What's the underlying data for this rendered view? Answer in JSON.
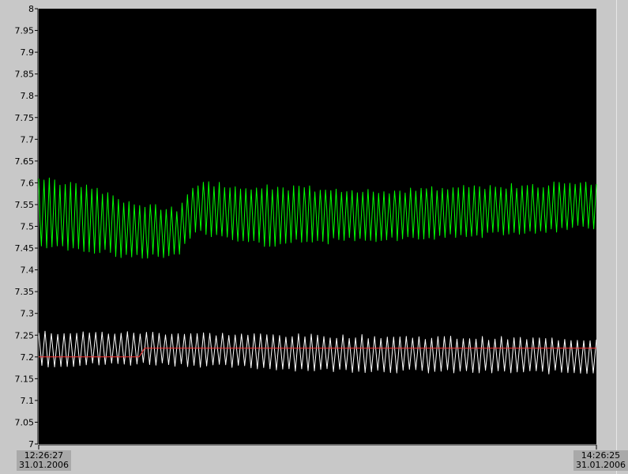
{
  "chart_data": {
    "type": "line",
    "title": "",
    "xlabel": "",
    "ylabel": "",
    "ylim": [
      7.0,
      8.0
    ],
    "y_ticks": [
      "8",
      "7.95",
      "7.9",
      "7.85",
      "7.8",
      "7.75",
      "7.7",
      "7.65",
      "7.6",
      "7.55",
      "7.5",
      "7.45",
      "7.4",
      "7.35",
      "7.3",
      "7.25",
      "7.2",
      "7.15",
      "7.1",
      "7.05",
      "7"
    ],
    "x_range": {
      "start_time": "12:26:27",
      "start_date": "31.01.2006",
      "end_time": "14:26:25",
      "end_date": "31.01.2006"
    },
    "grid": false,
    "background": "#000000",
    "series": [
      {
        "color": "#00ff00",
        "kind": "oscillating",
        "cycles": 105,
        "upper_envelope": [
          [
            0,
            7.61
          ],
          [
            0.07,
            7.59
          ],
          [
            0.12,
            7.58
          ],
          [
            0.17,
            7.55
          ],
          [
            0.25,
            7.54
          ],
          [
            0.28,
            7.6
          ],
          [
            0.4,
            7.59
          ],
          [
            0.6,
            7.58
          ],
          [
            0.8,
            7.59
          ],
          [
            1,
            7.6
          ]
        ],
        "lower_envelope": [
          [
            0,
            7.46
          ],
          [
            0.07,
            7.45
          ],
          [
            0.12,
            7.44
          ],
          [
            0.17,
            7.43
          ],
          [
            0.25,
            7.43
          ],
          [
            0.28,
            7.49
          ],
          [
            0.4,
            7.46
          ],
          [
            0.6,
            7.47
          ],
          [
            0.8,
            7.48
          ],
          [
            1,
            7.5
          ]
        ]
      },
      {
        "color": "#ffffff",
        "kind": "oscillating",
        "cycles": 88,
        "upper_envelope": [
          [
            0,
            7.255
          ],
          [
            0.2,
            7.255
          ],
          [
            0.5,
            7.248
          ],
          [
            0.8,
            7.243
          ],
          [
            1,
            7.24
          ]
        ],
        "lower_envelope": [
          [
            0,
            7.18
          ],
          [
            0.2,
            7.185
          ],
          [
            0.5,
            7.17
          ],
          [
            0.8,
            7.165
          ],
          [
            1,
            7.165
          ]
        ]
      },
      {
        "color": "#ff3333",
        "kind": "flat",
        "points": [
          [
            0,
            7.2
          ],
          [
            0.18,
            7.2
          ],
          [
            0.19,
            7.22
          ],
          [
            1,
            7.22
          ]
        ]
      }
    ]
  }
}
